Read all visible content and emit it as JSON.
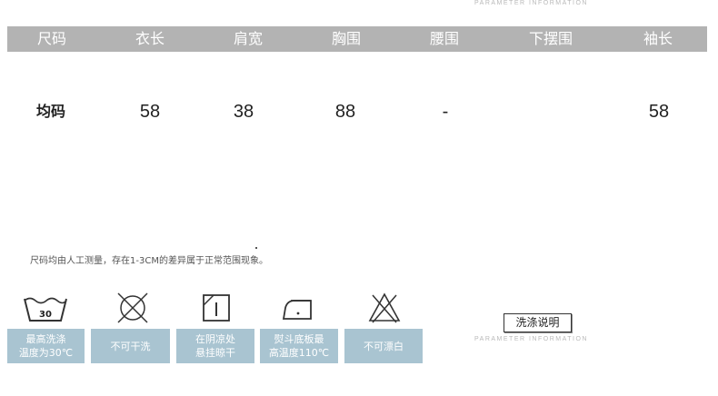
{
  "header": {
    "top_caption": "PARAMETER INFORMATION",
    "columns": [
      "尺码",
      "衣长",
      "肩宽",
      "胸围",
      "腰围",
      "下摆围",
      "袖长"
    ]
  },
  "size_row": {
    "label": "均码",
    "values": [
      "58",
      "38",
      "88",
      "-",
      "",
      "58"
    ]
  },
  "note": "尺码均由人工测量，存在1-3CM的差异属于正常范围现象。",
  "care": {
    "icons": [
      "wash-30-icon",
      "no-dry-clean-icon",
      "dry-in-shade-icon",
      "iron-icon",
      "no-bleach-icon"
    ],
    "wash_temp_label": "30",
    "labels": [
      "最高洗涤\n温度为30℃",
      "不可干洗",
      "在阴凉处\n悬挂晾干",
      "熨斗底板最\n高温度110℃",
      "不可漂白"
    ]
  },
  "wash_section": {
    "title": "洗涤说明",
    "caption": "PARAMETER INFORMATION"
  }
}
